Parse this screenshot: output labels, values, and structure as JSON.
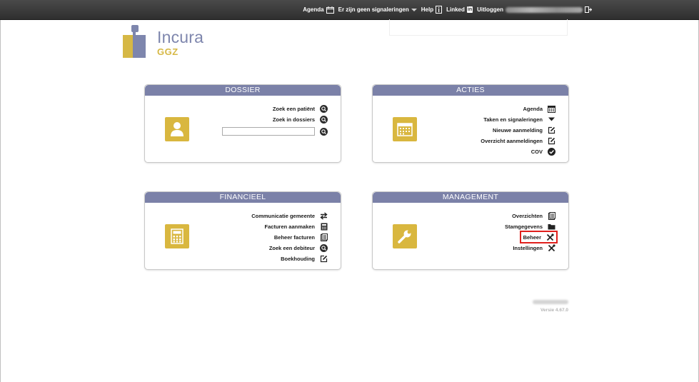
{
  "topbar": {
    "agenda": "Agenda",
    "signals": "Er zijn geen signaleringen",
    "help": "Help",
    "linked_prefix": "Linked",
    "linked_badge": "in",
    "logout": "Uitloggen"
  },
  "logo": {
    "name": "Incura",
    "sub": "GGZ"
  },
  "dossier": {
    "title": "DOSSIER",
    "links": [
      "Zoek een patiënt",
      "Zoek in dossiers"
    ],
    "search_value": ""
  },
  "acties": {
    "title": "ACTIES",
    "links": [
      "Agenda",
      "Taken en signaleringen",
      "Nieuwe aanmelding",
      "Overzicht aanmeldingen",
      "COV"
    ]
  },
  "financieel": {
    "title": "FINANCIEEL",
    "links": [
      "Communicatie gemeente",
      "Facturen aanmaken",
      "Beheer facturen",
      "Zoek een debiteur",
      "Boekhouding"
    ]
  },
  "management": {
    "title": "MANAGEMENT",
    "links": [
      "Overzichten",
      "Stamgegevens",
      "Beheer",
      "Instellingen"
    ]
  },
  "footer": {
    "version": "Versie 4.67.0"
  },
  "colors": {
    "accent": "#7b81a8",
    "gold": "#d9b73f",
    "highlight": "#e0201d"
  }
}
